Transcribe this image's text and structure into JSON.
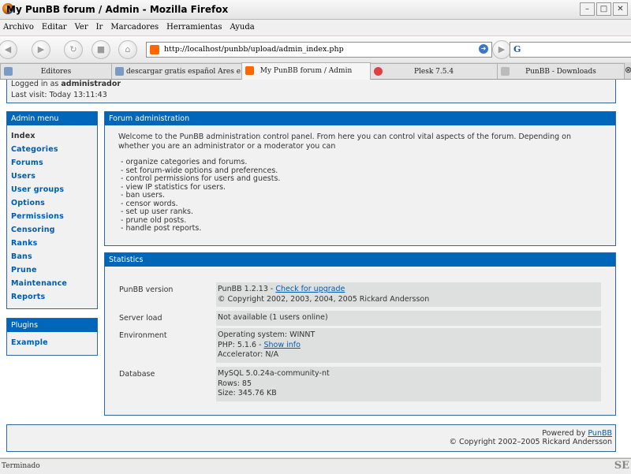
{
  "window": {
    "title": "My PunBB forum / Admin - Mozilla Firefox"
  },
  "menubar": [
    "Archivo",
    "Editar",
    "Ver",
    "Ir",
    "Marcadores",
    "Herramientas",
    "Ayuda"
  ],
  "navbar": {
    "url": "http://localhost/punbb/upload/admin_index.php",
    "search_engine": "G"
  },
  "tabs": [
    {
      "label": "Editores"
    },
    {
      "label": "descargar gratis español Ares e..."
    },
    {
      "label": "My PunBB forum / Admin"
    },
    {
      "label": "Plesk 7.5.4"
    },
    {
      "label": "PunBB - Downloads"
    }
  ],
  "login": {
    "logged_in_prefix": "Logged in as ",
    "username": "administrador",
    "last_visit": "Last visit: Today 13:11:43"
  },
  "admin_menu": {
    "title": "Admin menu",
    "items": [
      "Index",
      "Categories",
      "Forums",
      "Users",
      "User groups",
      "Options",
      "Permissions",
      "Censoring",
      "Ranks",
      "Bans",
      "Prune",
      "Maintenance",
      "Reports"
    ]
  },
  "plugins": {
    "title": "Plugins",
    "items": [
      "Example"
    ]
  },
  "forum_admin": {
    "title": "Forum administration",
    "intro": "Welcome to the PunBB administration control panel. From here you can control vital aspects of the forum. Depending on whether you are an administrator or a moderator you can",
    "bullets": [
      "- organize categories and forums.",
      "- set forum-wide options and preferences.",
      "- control permissions for users and guests.",
      "- view IP statistics for users.",
      "- ban users.",
      "- censor words.",
      "- set up user ranks.",
      "- prune old posts.",
      "- handle post reports."
    ]
  },
  "statistics": {
    "title": "Statistics",
    "punbb_label": "PunBB version",
    "punbb_version": "PunBB 1.2.13 - ",
    "upgrade_link": "Check for upgrade",
    "copyright": "© Copyright 2002, 2003, 2004, 2005 Rickard Andersson",
    "server_label": "Server load",
    "server_value": "Not available (1 users online)",
    "env_label": "Environment",
    "os": "Operating system: WINNT",
    "php": "PHP: 5.1.6 - ",
    "php_link": "Show info",
    "accelerator": "Accelerator: N/A",
    "db_label": "Database",
    "db_version": "MySQL 5.0.24a-community-nt",
    "db_rows": "Rows: 85",
    "db_size": "Size: 345.76 KB"
  },
  "footer": {
    "powered_by": "Powered by ",
    "punbb_link": "PunBB",
    "copyright": "© Copyright 2002–2005 Rickard Andersson"
  },
  "statusbar": {
    "text": "Terminado"
  }
}
